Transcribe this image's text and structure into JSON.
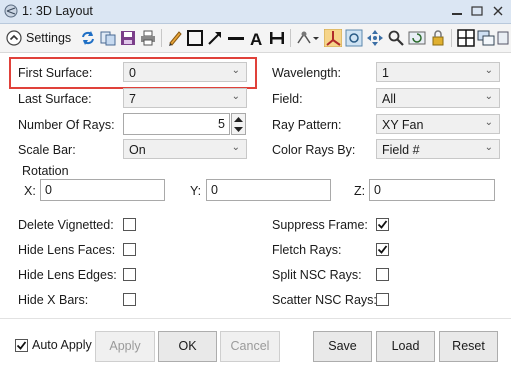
{
  "window": {
    "title": "1: 3D Layout"
  },
  "toolbar": {
    "settings_label": "Settings"
  },
  "form": {
    "first_surface": {
      "label": "First Surface:",
      "value": "0"
    },
    "last_surface": {
      "label": "Last Surface:",
      "value": "7"
    },
    "number_of_rays": {
      "label": "Number Of Rays:",
      "value": "5"
    },
    "scale_bar": {
      "label": "Scale Bar:",
      "value": "On"
    },
    "wavelength": {
      "label": "Wavelength:",
      "value": "1"
    },
    "field": {
      "label": "Field:",
      "value": "All"
    },
    "ray_pattern": {
      "label": "Ray Pattern:",
      "value": "XY Fan"
    },
    "color_rays_by": {
      "label": "Color Rays By:",
      "value": "Field #"
    },
    "rotation": {
      "label": "Rotation",
      "x_label": "X:",
      "x": "0",
      "y_label": "Y:",
      "y": "0",
      "z_label": "Z:",
      "z": "0"
    },
    "delete_vignetted": {
      "label": "Delete Vignetted:",
      "checked": false
    },
    "hide_lens_faces": {
      "label": "Hide Lens Faces:",
      "checked": false
    },
    "hide_lens_edges": {
      "label": "Hide Lens Edges:",
      "checked": false
    },
    "hide_x_bars": {
      "label": "Hide X Bars:",
      "checked": false
    },
    "suppress_frame": {
      "label": "Suppress Frame:",
      "checked": true
    },
    "fletch_rays": {
      "label": "Fletch Rays:",
      "checked": true
    },
    "split_nsc_rays": {
      "label": "Split NSC Rays:",
      "checked": false
    },
    "scatter_nsc_rays": {
      "label": "Scatter NSC Rays:",
      "checked": false
    }
  },
  "buttons": {
    "auto_apply": {
      "label": "Auto Apply",
      "checked": true
    },
    "apply": "Apply",
    "ok": "OK",
    "cancel": "Cancel",
    "save": "Save",
    "load": "Load",
    "reset": "Reset"
  },
  "colors": {
    "highlight": "#e0413a",
    "titlebar": "#dbe6f3",
    "accent": "#1f6fc5"
  }
}
